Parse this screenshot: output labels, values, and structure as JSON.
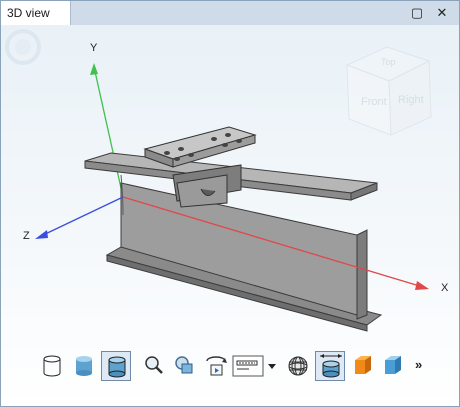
{
  "window": {
    "tab_title": "3D view",
    "maximize_icon": "maximize-icon",
    "close_icon": "close-icon",
    "close_symbol": "✕",
    "maximize_symbol": "▢"
  },
  "viewport": {
    "axes": {
      "x_label": "X",
      "y_label": "Y",
      "z_label": "Z"
    },
    "colors": {
      "x_axis": "#e0484a",
      "y_axis": "#3ec24a",
      "z_axis": "#3a4fe0"
    },
    "view_cube": {
      "front_label": "Front",
      "right_label": "Right",
      "top_label": "Top"
    }
  },
  "toolbar": {
    "buttons": [
      {
        "name": "wireframe-view-button",
        "icon": "wireframe-cylinder-icon",
        "active": false
      },
      {
        "name": "shaded-view-button",
        "icon": "shaded-cylinder-icon",
        "active": false
      },
      {
        "name": "shaded-edges-view-button",
        "icon": "shaded-edges-cylinder-icon",
        "active": true
      },
      {
        "name": "zoom-button",
        "icon": "magnifier-icon",
        "active": false
      },
      {
        "name": "zoom-extents-button",
        "icon": "zoom-extents-icon",
        "active": false
      },
      {
        "name": "rotate-button",
        "icon": "rotate-icon",
        "active": false
      },
      {
        "name": "display-options-dropdown",
        "icon": "display-options-icon",
        "active": false
      },
      {
        "name": "mesh-view-button",
        "icon": "mesh-sphere-icon",
        "active": false
      },
      {
        "name": "dimensions-button",
        "icon": "dimension-cylinder-icon",
        "active": true
      },
      {
        "name": "orange-box-button",
        "icon": "orange-box-icon",
        "active": false
      },
      {
        "name": "blue-box-button",
        "icon": "blue-box-icon",
        "active": false
      }
    ],
    "more_label": "»"
  }
}
